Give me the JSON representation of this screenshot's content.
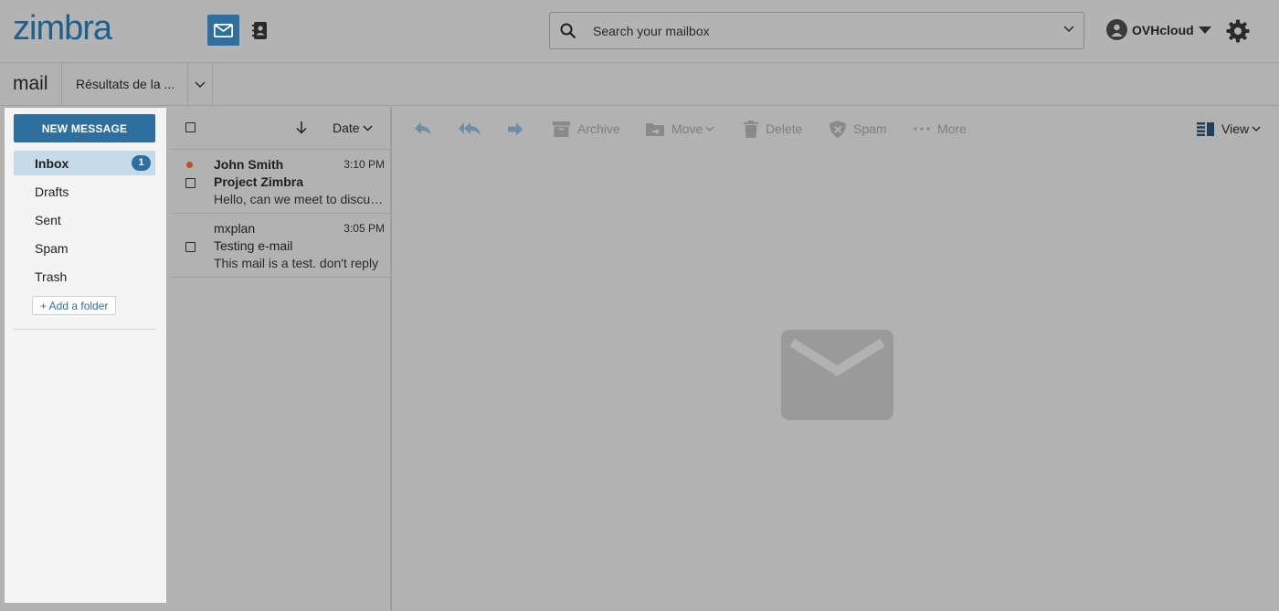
{
  "header": {
    "logo": "zimbra",
    "search_placeholder": "Search your mailbox",
    "account_name": "OVHcloud"
  },
  "subheader": {
    "title": "mail",
    "tab_label": "Résultats de la ..."
  },
  "sidebar": {
    "new_message_label": "NEW MESSAGE",
    "folders": [
      {
        "label": "Inbox",
        "badge": "1",
        "active": true
      },
      {
        "label": "Drafts"
      },
      {
        "label": "Sent"
      },
      {
        "label": "Spam"
      },
      {
        "label": "Trash"
      }
    ],
    "add_folder_label": "+ Add a folder"
  },
  "list": {
    "sort_label": "Date",
    "messages": [
      {
        "from": "John Smith",
        "time": "3:10 PM",
        "subject": "Project Zimbra",
        "preview": "Hello, can we meet to discuss the project?",
        "unread": true
      },
      {
        "from": "mxplan",
        "time": "3:05 PM",
        "subject": "Testing e-mail",
        "preview": "This mail is a test. don't reply",
        "unread": false
      }
    ]
  },
  "toolbar": {
    "archive": "Archive",
    "move": "Move",
    "delete": "Delete",
    "spam": "Spam",
    "more": "More",
    "view": "View"
  },
  "colors": {
    "brand": "#2f6f9f",
    "logo": "#1d5f8f",
    "unread_dot": "#c2501f",
    "overlay_gray": "#b2b2b2"
  }
}
